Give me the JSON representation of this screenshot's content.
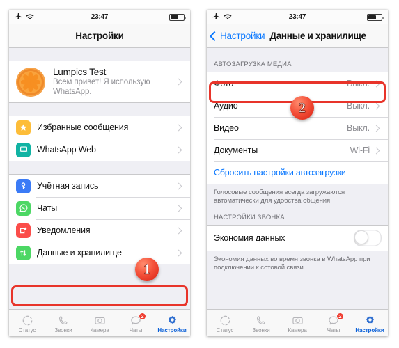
{
  "left_phone": {
    "status_bar": {
      "airplane_icon": "airplane-icon",
      "wifi_icon": "wifi-icon",
      "time": "23:47",
      "battery_icon": "battery-icon"
    },
    "nav": {
      "title": "Настройки"
    },
    "profile": {
      "avatar_icon": "orange-slice-avatar",
      "name": "Lumpics Test",
      "status": "Всем привет! Я использую WhatsApp."
    },
    "group1": [
      {
        "label": "Избранные сообщения",
        "icon": "star-icon",
        "color": "#fdbd39"
      },
      {
        "label": "WhatsApp Web",
        "icon": "laptop-icon",
        "color": "#11b3a3"
      }
    ],
    "group2": [
      {
        "label": "Учётная запись",
        "icon": "key-icon",
        "color": "#3b7bf6"
      },
      {
        "label": "Чаты",
        "icon": "whatsapp-icon",
        "color": "#4cd764"
      },
      {
        "label": "Уведомления",
        "icon": "notification-icon",
        "color": "#fb4d4a"
      },
      {
        "label": "Данные и хранилище",
        "icon": "data-transfer-icon",
        "color": "#4cd764"
      }
    ],
    "tabs": [
      {
        "label": "Статус",
        "icon": "status-icon",
        "active": false,
        "badge": ""
      },
      {
        "label": "Звонки",
        "icon": "phone-icon",
        "active": false,
        "badge": ""
      },
      {
        "label": "Камера",
        "icon": "camera-icon",
        "active": false,
        "badge": ""
      },
      {
        "label": "Чаты",
        "icon": "chat-icon",
        "active": false,
        "badge": "2"
      },
      {
        "label": "Настройки",
        "icon": "gear-icon",
        "active": true,
        "badge": ""
      }
    ],
    "callout": "1"
  },
  "right_phone": {
    "status_bar": {
      "airplane_icon": "airplane-icon",
      "wifi_icon": "wifi-icon",
      "time": "23:47",
      "battery_icon": "battery-icon"
    },
    "nav": {
      "back_label": "Настройки",
      "title": "Данные и хранилище"
    },
    "section_media": {
      "header": "АВТОЗАГРУЗКА МЕДИА",
      "rows": [
        {
          "label": "Фото",
          "value": "Выкл."
        },
        {
          "label": "Аудио",
          "value": "Выкл."
        },
        {
          "label": "Видео",
          "value": "Выкл."
        },
        {
          "label": "Документы",
          "value": "Wi-Fi"
        }
      ],
      "reset_link": "Сбросить настройки автозагрузки",
      "footer": "Голосовые сообщения всегда загружаются автоматически для удобства общения."
    },
    "section_call": {
      "header": "НАСТРОЙКИ ЗВОНКА",
      "row_label": "Экономия данных",
      "toggle_state": "off",
      "footer": "Экономия данных во время звонка в WhatsApp при подключении к сотовой связи."
    },
    "tabs": [
      {
        "label": "Статус",
        "icon": "status-icon",
        "active": false,
        "badge": ""
      },
      {
        "label": "Звонки",
        "icon": "phone-icon",
        "active": false,
        "badge": ""
      },
      {
        "label": "Камера",
        "icon": "camera-icon",
        "active": false,
        "badge": ""
      },
      {
        "label": "Чаты",
        "icon": "chat-icon",
        "active": false,
        "badge": "2"
      },
      {
        "label": "Настройки",
        "icon": "gear-icon",
        "active": true,
        "badge": ""
      }
    ],
    "callout": "2"
  },
  "colors": {
    "accent_blue": "#0a78ff",
    "highlight_red": "#e8342a",
    "muted_gray": "#8e8e93",
    "page_bg": "#efeff4"
  }
}
